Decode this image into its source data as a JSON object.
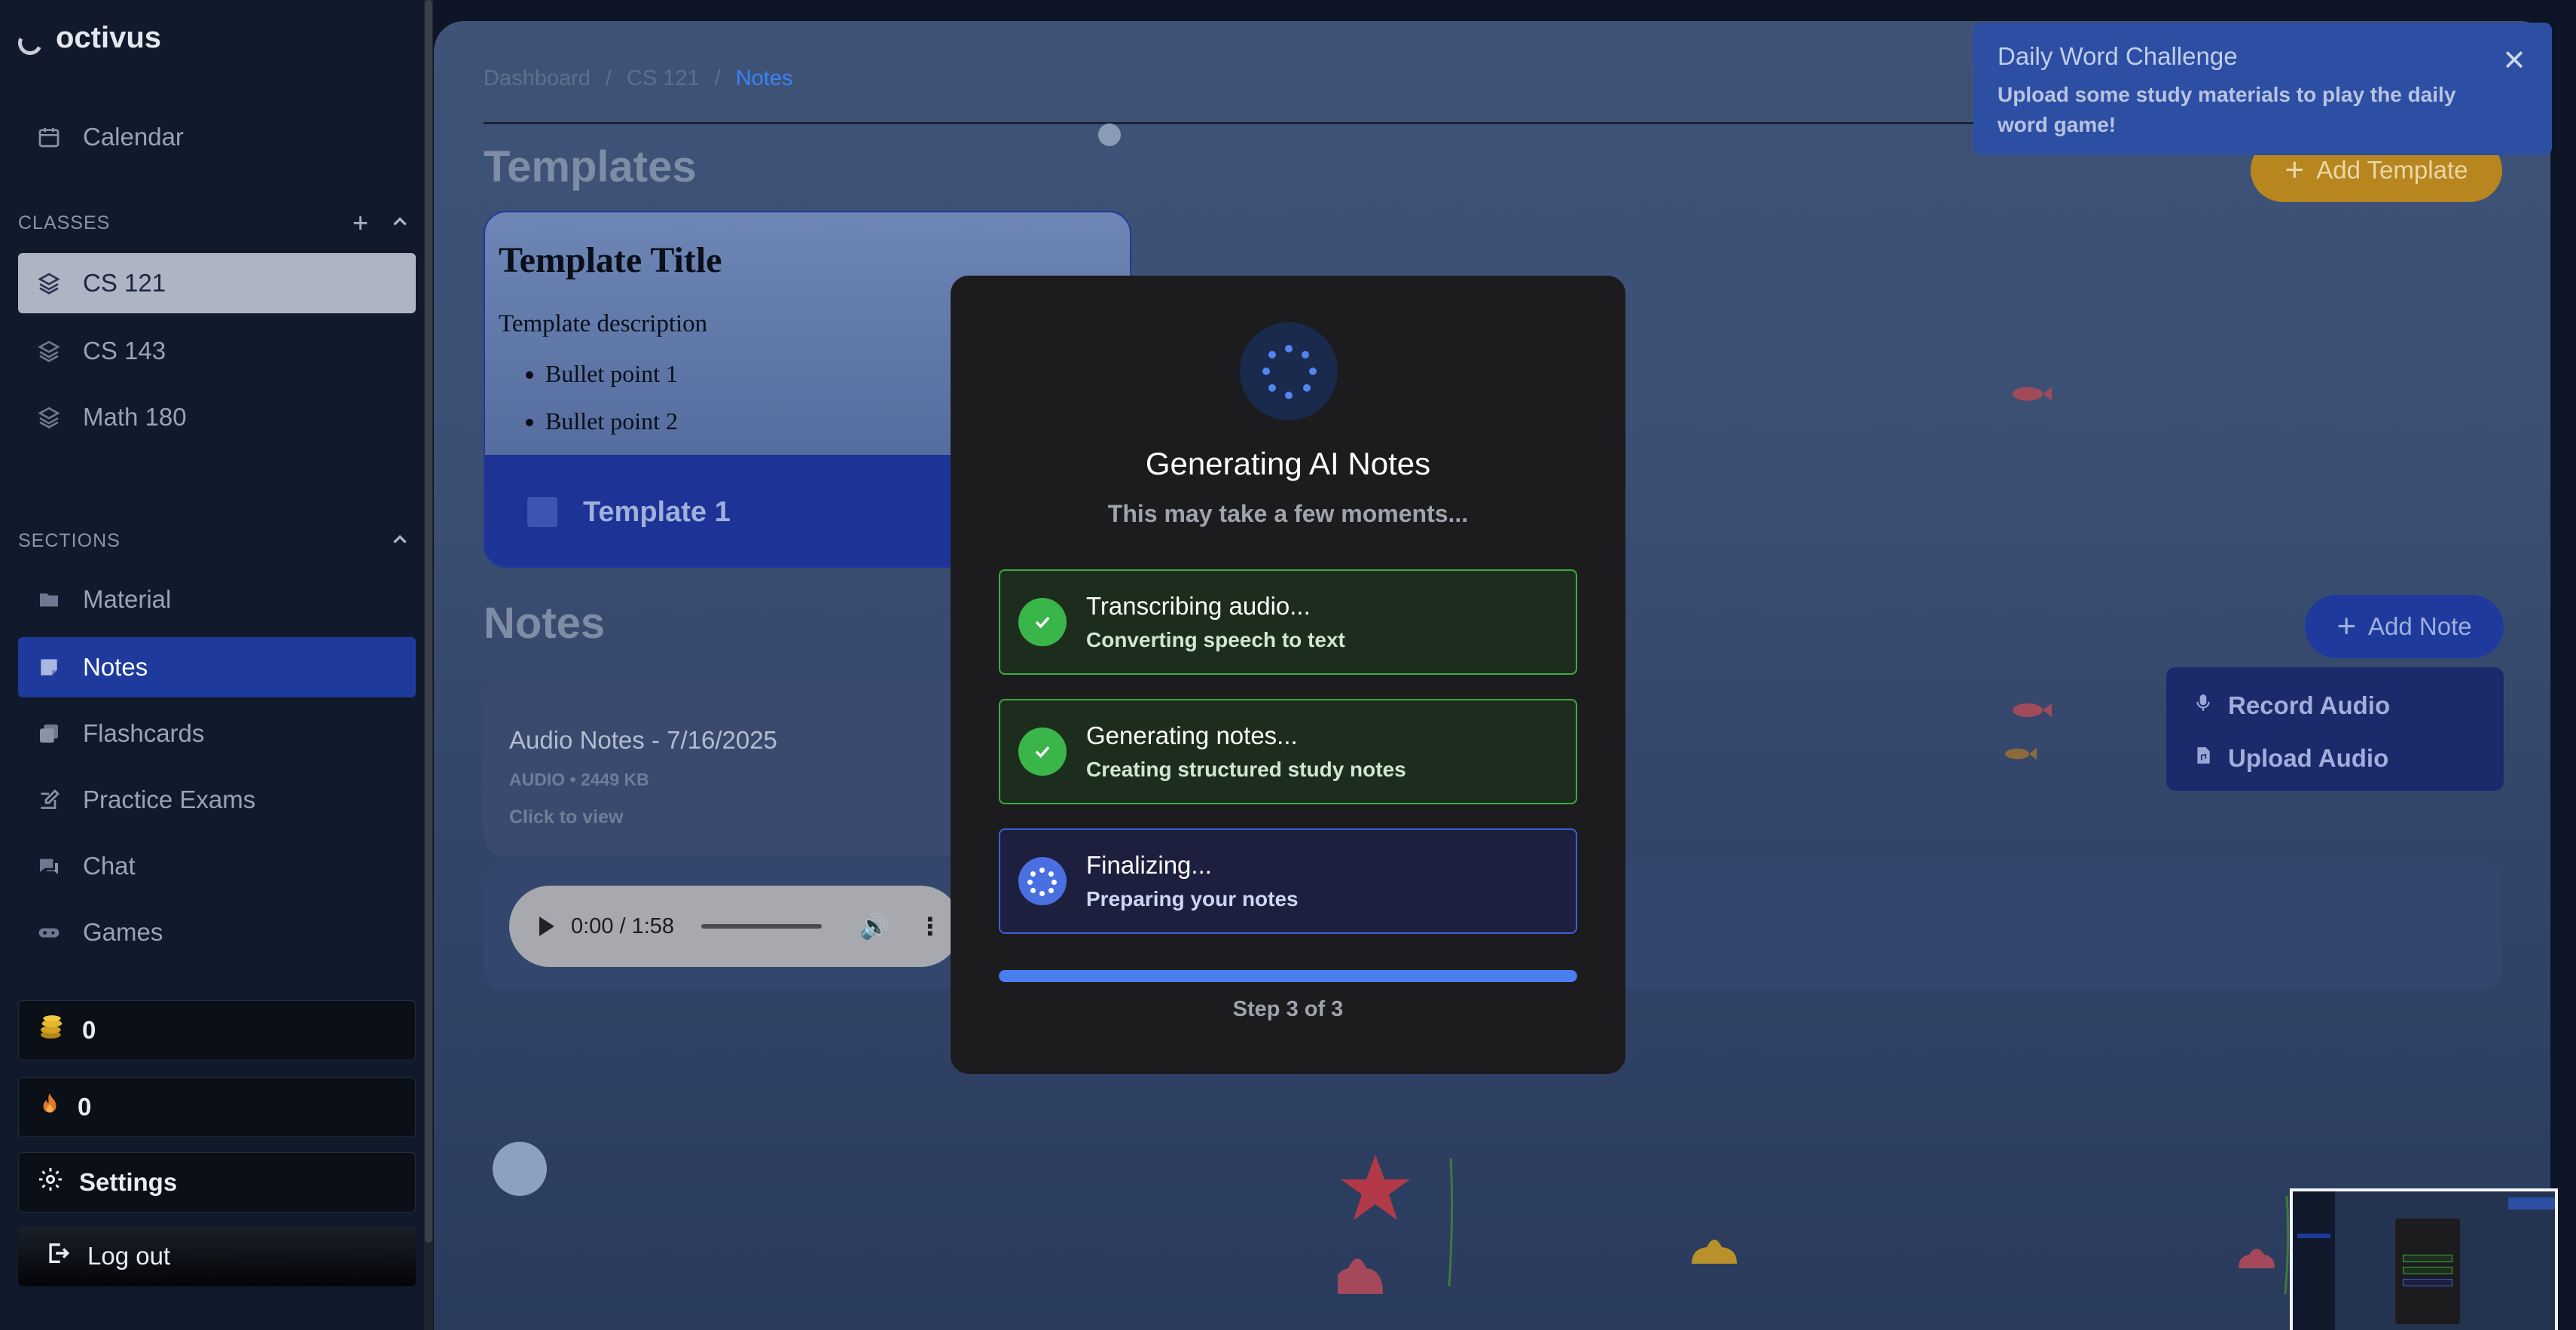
{
  "app": {
    "name": "octivus"
  },
  "sidebar": {
    "calendar_label": "Calendar",
    "classes_heading": "CLASSES",
    "classes": [
      {
        "label": "CS 121"
      },
      {
        "label": "CS 143"
      },
      {
        "label": "Math 180"
      }
    ],
    "sections_heading": "SECTIONS",
    "sections": [
      {
        "label": "Material"
      },
      {
        "label": "Notes"
      },
      {
        "label": "Flashcards"
      },
      {
        "label": "Practice Exams"
      },
      {
        "label": "Chat"
      },
      {
        "label": "Games"
      }
    ],
    "coins": "0",
    "streak": "0",
    "settings_label": "Settings",
    "logout_label": "Log out"
  },
  "breadcrumb": {
    "items": [
      "Dashboard",
      "CS 121",
      "Notes"
    ],
    "separator": "/"
  },
  "templates": {
    "heading": "Templates",
    "add_label": "Add Template",
    "card": {
      "title": "Template Title",
      "description": "Template description",
      "bullets": [
        "Bullet point 1",
        "Bullet point 2"
      ],
      "name": "Template 1"
    }
  },
  "notes": {
    "heading": "Notes",
    "add_label": "Add Note",
    "menu": {
      "record": "Record Audio",
      "upload": "Upload Audio"
    },
    "card": {
      "title": "Audio Notes - 7/16/2025",
      "meta": "AUDIO • 2449 KB",
      "hint": "Click to view"
    },
    "player": {
      "time": "0:00 / 1:58"
    }
  },
  "toast": {
    "title": "Daily Word Challenge",
    "message": "Upload some study materials to play the daily word game!"
  },
  "modal": {
    "title": "Generating AI Notes",
    "subtitle": "This may take a few moments...",
    "steps": [
      {
        "label": "Transcribing audio...",
        "detail": "Converting speech to text",
        "status": "done"
      },
      {
        "label": "Generating notes...",
        "detail": "Creating structured study notes",
        "status": "done"
      },
      {
        "label": "Finalizing...",
        "detail": "Preparing your notes",
        "status": "active"
      }
    ],
    "progress": 1.0,
    "step_text": "Step 3 of 3"
  },
  "colors": {
    "accent_blue": "#1e3a9c",
    "success_green": "#3ab54a",
    "template_gold": "#b8861f"
  }
}
